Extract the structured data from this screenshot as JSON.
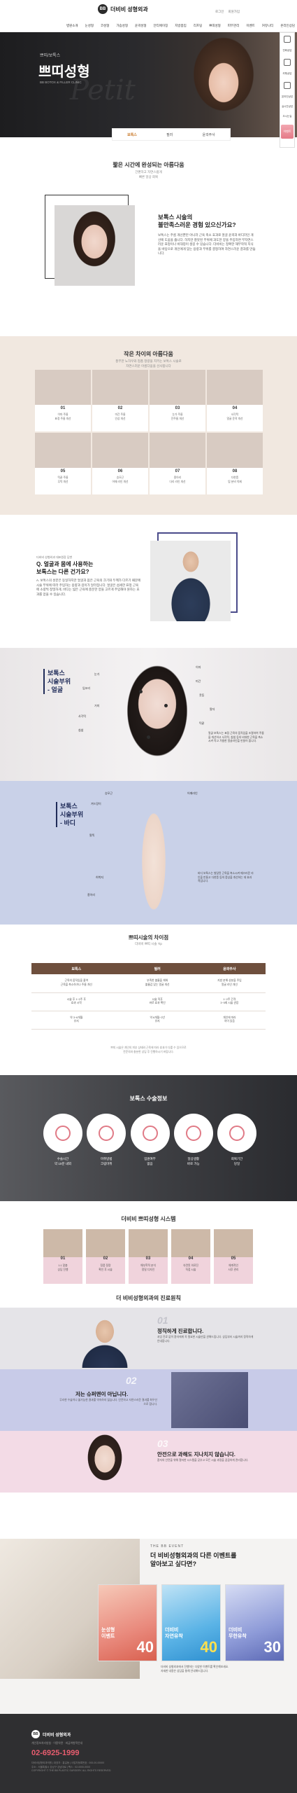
{
  "header": {
    "logo_mark": "BB",
    "logo_text": "더비비 성형외과",
    "nav": [
      "병원소개",
      "눈성형",
      "코성형",
      "가슴성형",
      "윤곽성형",
      "안티에이징",
      "지방흡입",
      "리프팅",
      "쁘띠성형",
      "피부관리",
      "이벤트",
      "커뮤니티",
      "온라인상담"
    ],
    "util": [
      "로그인",
      "회원가입"
    ]
  },
  "quickmenu": {
    "items": [
      "전화상담",
      "카톡상담",
      "온라인상담",
      "실시간상담",
      "오시는길"
    ],
    "top_label": "이벤트"
  },
  "hero": {
    "sub": "쁘띠/보톡스",
    "title": "쁘띠성형",
    "desc": "BB BOTOX & FILLER CLINIC",
    "watermark": "Petit"
  },
  "subtabs": [
    "보톡스",
    "필러",
    "윤곽주사"
  ],
  "intro": {
    "title": "짧은 시간에 완성되는 아름다움",
    "sub": "간편하고 자연스럽게\n빠른 일상 회복",
    "heading": "보톡스 시술의\n불만족스러운 경험 있으신가요?",
    "body": "보톡스는 주름 개선뿐만 아니라 근육 축소 효과로 얼굴 윤곽과 바디라인 개선에 도움을 줍니다. 하지만 잘못된 부위에 과도한 양을 주입하면 부자연스러운 표정이나 비대칭이 생길 수 있습니다. 더비비는 정확한 해부학적 지식을 바탕으로 개인에게 맞는 용량과 부위를 결정하여 자연스러운 결과를 만듭니다."
  },
  "difference": {
    "title": "작은 차이의 아름다움",
    "sub": "풍부한 노하우와 정품 정량을 지키는 보톡스 시술로\n자연스러운 아름다움을 선사합니다",
    "cards": [
      {
        "num": "01",
        "text": "이마 주름\n표정 주름 개선"
      },
      {
        "num": "02",
        "text": "미간 주름\n인상 개선"
      },
      {
        "num": "03",
        "text": "눈가 주름\n잔주름 개선"
      },
      {
        "num": "04",
        "text": "사각턱\n얼굴 윤곽 개선"
      },
      {
        "num": "05",
        "text": "턱끝 주름\n무턱 개선"
      },
      {
        "num": "06",
        "text": "승모근\n어깨 라인 개선"
      },
      {
        "num": "07",
        "text": "종아리\n다리 라인 개선"
      },
      {
        "num": "08",
        "text": "다한증\n땀 분비 억제"
      }
    ]
  },
  "doctor_q": {
    "label": "더비비 성형외과 대표원장 답변",
    "heading": "Q. 얼굴과 몸에 사용하는\n보톡스는 다른 건가요?",
    "body": "A. 보톡스의 성분은 동일하지만 얼굴과 몸은 근육의 크기와 두께가 다르기 때문에 시술 부위에 따라 주입하는 용량과 깊이가 달라집니다. 얼굴은 섬세한 표정 근육에 소량씩 정밀하게, 바디는 넓은 근육에 충분한 양을 고르게 주입해야 원하는 효과를 얻을 수 있습니다."
  },
  "botox_face": {
    "label": "보톡스\n시술부위\n- 얼굴",
    "tags": [
      "눈가",
      "이마",
      "미간",
      "콧등",
      "입꼬리",
      "턱끝",
      "사각턱",
      "침샘",
      "팔자",
      "거미"
    ],
    "desc": "얼굴 보톡스는 표정 근육의 움직임을 조절하여 주름을 개선하고 사각턱, 침샘 등의 비대한 근육을 축소시켜 작고 갸름한 얼굴라인을 만들어 줍니다."
  },
  "botox_body": {
    "label": "보톡스\n시술부위\n- 바디",
    "tags": [
      "승모근",
      "겨드랑이",
      "팔뚝",
      "허벅지",
      "종아리",
      "어깨라인"
    ],
    "desc": "바디 보톡스는 발달된 근육을 축소시켜 매끄러운 라인을 만들고 다한증 등의 증상을 개선하는 데 효과적입니다."
  },
  "compare": {
    "title": "쁘띠시술의 차이점",
    "sub": "더비비 쁘띠 시술 Tip",
    "headers": [
      "보톡스",
      "필러",
      "윤곽주사"
    ],
    "rows": [
      [
        "근육의 움직임을 줄여\n근육을 축소하거나 주름 개선",
        "부족한 볼륨을 채워\n볼륨감 있는 얼굴 개선",
        "지방 분해 성분을 주입\n얼굴 라인 개선"
      ],
      [
        "시술 후 1~2주 후\n효과 시작",
        "시술 직후\n바로 효과 확인",
        "1~2주 간격\n3~5회 시술 권장"
      ],
      [
        "약 3~6개월\n유지",
        "약 6개월~2년\n유지",
        "개인에 따라\n차이 있음"
      ]
    ],
    "note": "쁘띠 시술은 개인의 피부 상태와 근육에 따라 효과가 다를 수 있으므로\n전문의와 충분한 상담 후 진행하시기 바랍니다."
  },
  "surgery_info": {
    "title": "보톡스 수술정보",
    "items": [
      "수술시간\n약 10분 내외",
      "마취방법\n크림마취",
      "입원여부\n없음",
      "일상생활\n바로 가능",
      "회복기간\n당일"
    ]
  },
  "system": {
    "title": "더비비 쁘띠성형 시스템",
    "cards": [
      {
        "num": "01",
        "text": "1:1 맞춤\n상담 진행"
      },
      {
        "num": "02",
        "text": "정품 정량\n확인 후 시술"
      },
      {
        "num": "03",
        "text": "해부학적 분석\n정밀 디자인"
      },
      {
        "num": "04",
        "text": "숙련된 의료진\n직접 시술"
      },
      {
        "num": "05",
        "text": "체계적인\n사후 관리"
      }
    ]
  },
  "principles": {
    "title": "더 비비성형외과의 진료원칙",
    "items": [
      {
        "num": "01",
        "heading": "정직하게 진료합니다.",
        "body": "과잉 진료 없이 환자에게 꼭 필요한 시술만을 권해드립니다. 상담부터 시술까지 정직하게 안내합니다."
      },
      {
        "num": "02",
        "heading": "저는 슈퍼맨이 아닙니다.",
        "body": "무리한 수술이나 불가능한 결과를 약속하지 않습니다. 안전하고 자연스러운 결과를 최우선으로 합니다."
      },
      {
        "num": "03",
        "heading": "안전으로 과해도 지나치지 않습니다.",
        "body": "환자의 안전을 위해 철저한 시스템을 갖추고 모든 시술 과정을 꼼꼼하게 관리합니다."
      }
    ]
  },
  "event": {
    "label": "THE BB EVENT",
    "heading": "더 비비성형외과의 다른 이벤트를\n알아보고 싶다면?",
    "cards": [
      {
        "name": "눈성형\n이벤트",
        "price": "40"
      },
      {
        "name": "더비비\n자연유착",
        "price": "40"
      },
      {
        "name": "더비비\n무한유착",
        "price": "30"
      }
    ],
    "text": "더비비 성형외과에서 진행하는 다양한 이벤트를 확인해보세요.\n자세한 내용은 상담을 통해 안내해드립니다."
  },
  "footer": {
    "logo_mark": "BB",
    "logo_text": "더비비 성형외과",
    "links": "개인정보처리방침 · 이용약관 · 비급여항목안내",
    "phone": "02-6925-1999",
    "info": "더비비성형외과의원 | 대표자 : 홍길동 | 사업자등록번호 : 000-00-00000\n주소 : 서울특별시 강남구 강남대로 | 팩스 : 02-0000-0000\nCOPYRIGHT © THE BB PLASTIC SURGERY. ALL RIGHTS RESERVED."
  }
}
